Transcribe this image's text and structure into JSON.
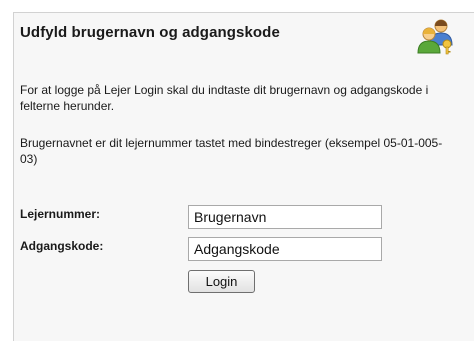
{
  "login_box": {
    "title": "Udfyld brugernavn og adgangskode",
    "instructions": "For at logge på Lejer Login skal du indtaste dit brugernavn og adgangskode i felterne herunder.",
    "username_hint": "Brugernavnet er dit lejernummer tastet med bindestreger (eksempel 05-01-005-03)",
    "icon": "users-icon"
  },
  "form": {
    "username_label": "Lejernummer:",
    "username_value": "Brugernavn",
    "password_label": "Adgangskode:",
    "password_value": "Adgangskode",
    "login_label": "Login"
  },
  "colors": {
    "panel_background": "#f7f7f7",
    "text": "#1a1a1a"
  }
}
